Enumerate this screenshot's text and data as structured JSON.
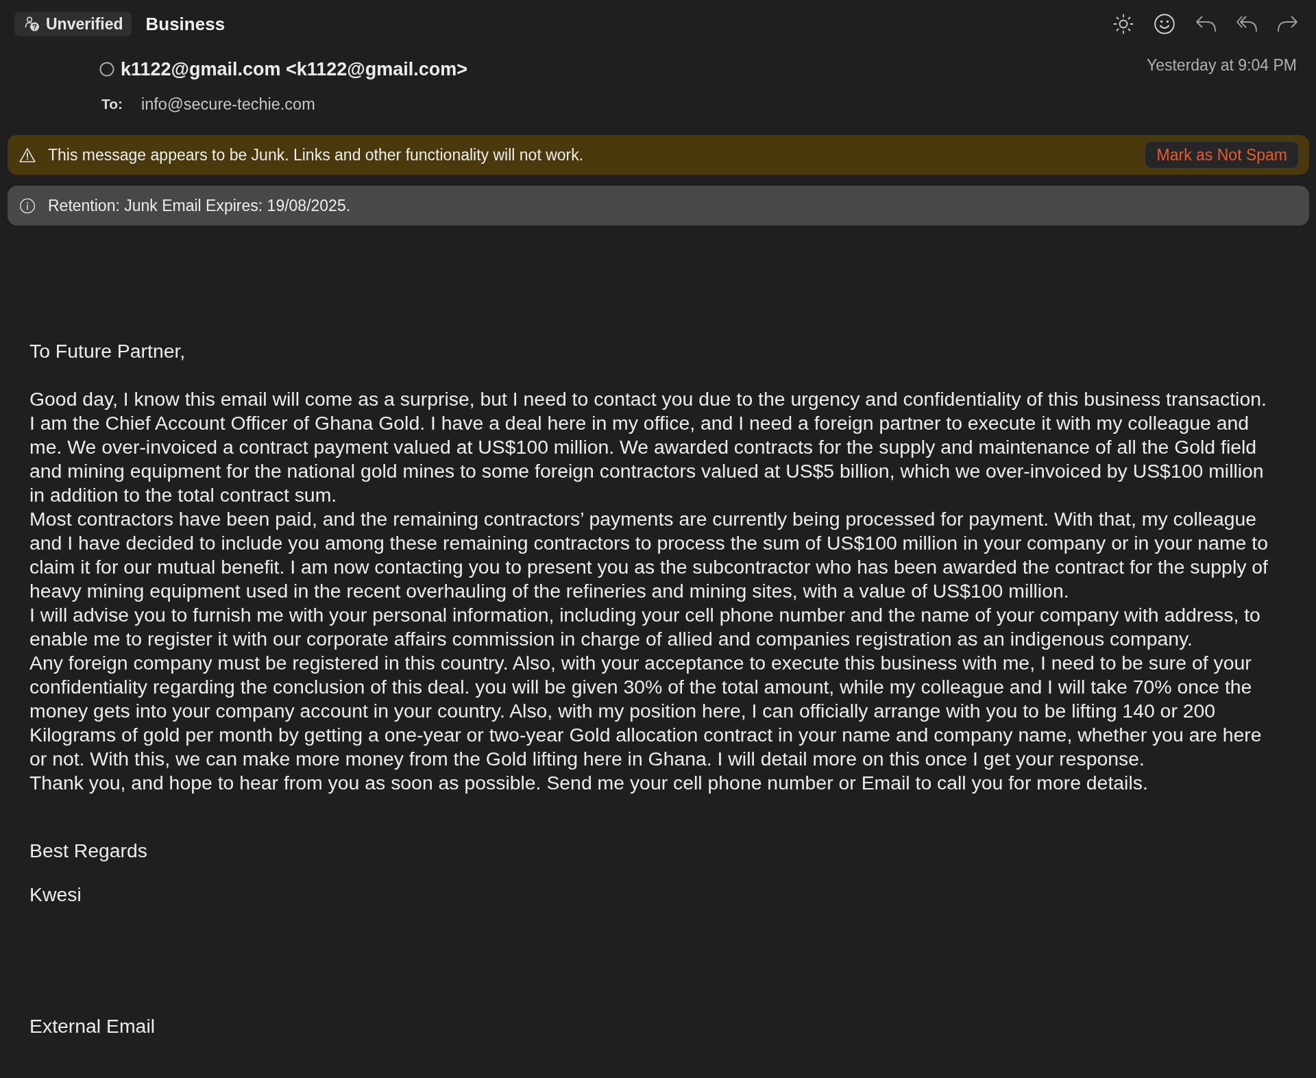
{
  "header": {
    "badge": "Unverified",
    "subject": "Business"
  },
  "message": {
    "sender": "k1122@gmail.com <k1122@gmail.com>",
    "date": "Yesterday at 9:04 PM",
    "to_label": "To:",
    "to": "info@secure-techie.com"
  },
  "banners": [
    {
      "kind": "warning",
      "text": "This message appears to be Junk. Links and other functionality will not work.",
      "action": "Mark as Not Spam"
    },
    {
      "kind": "info",
      "text": "Retention: Junk Email Expires: 19/08/2025."
    }
  ],
  "body": {
    "greeting": "To Future Partner,",
    "paragraphs": [
      "Good day, I know this email will come as a surprise, but I need to contact you due to the urgency and confidentiality of this business transaction.",
      "I am the Chief Account Officer of Ghana Gold. I have a deal here in my office, and I need a foreign partner to execute it with my colleague and me. We over-invoiced a contract payment valued at US$100 million. We awarded contracts for the supply and maintenance of all the Gold field and mining equipment for the national gold mines to some foreign contractors valued at US$5 billion, which we over-invoiced by US$100 million in addition to the total contract sum.",
      "Most contractors have been paid, and the remaining contractors’ payments are currently being processed for payment. With that, my colleague and I have decided to include you among these remaining contractors to process the sum of US$100 million in your company or in your name to claim it for our mutual benefit. I am now contacting you to present you as the subcontractor who has been awarded the contract for the supply of heavy mining equipment used in the recent overhauling of the refineries and mining sites, with a value of US$100 million.",
      "I will advise you to furnish me with your personal information, including your cell phone number and the name of your company with address, to enable me to register it with our corporate affairs commission in charge of allied and companies registration as an indigenous company.",
      "Any foreign company must be registered in this country. Also, with your acceptance to execute this business with me, I need to be sure of your confidentiality regarding the conclusion of this deal. you will be given 30% of the total amount, while my colleague and I will take 70% once the money gets into your company account in your country. Also, with my position here, I can officially arrange with you to be lifting 140 or 200 Kilograms of gold per month by getting a one-year or two-year Gold allocation contract in your name and company name, whether you are here or not. With this, we can make more money from the Gold lifting here in Ghana. I will detail more on this once I get your response.",
      "Thank you, and hope to hear from you as soon as possible. Send me your cell phone number or Email to call you for more details."
    ],
    "closing": "Best Regards",
    "signature": "Kwesi",
    "footer": "External Email"
  }
}
